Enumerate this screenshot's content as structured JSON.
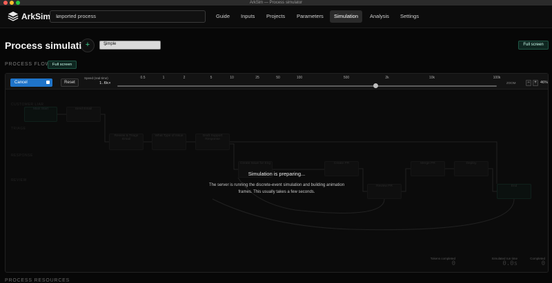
{
  "window": {
    "title": "ArkSim — Process simulator"
  },
  "app": {
    "brand": "ArkSim",
    "process_select": "Imported process",
    "nav": [
      "Guide",
      "Inputs",
      "Projects",
      "Parameters",
      "Simulation",
      "Analysis",
      "Settings"
    ],
    "active_nav": "Simulation"
  },
  "page": {
    "title": "Process simulation",
    "add_label": "+",
    "sim_mode": "Simple",
    "full_screen": "Full screen"
  },
  "section": {
    "label": "PROCESS FLOW",
    "full_screen": "Full screen"
  },
  "toolbar": {
    "cancel": "Cancel",
    "reset": "Reset",
    "speed_label": "Speed (real-time)",
    "speed_value": "1.6k×",
    "speed_ticks": [
      "0.5",
      "1",
      "2",
      "5",
      "10",
      "25",
      "50",
      "100",
      "500",
      "2k",
      "10k",
      "100k"
    ],
    "speed_position": 0.68,
    "zoom_label": "ZOOM",
    "zoom_minus": "−",
    "zoom_plus": "+",
    "zoom_value": "46%"
  },
  "diagram": {
    "lanes": [
      "CUSTOMER LIAR",
      "TRIAGE",
      "RESPONSE",
      "REVIEW"
    ],
    "nodes": [
      "Main Start",
      "Send Email",
      "Review & Triage Email",
      "What Type of Issue",
      "Draft Support Response",
      "Create Issue for Eng",
      "Create PR",
      "Review PR",
      "Merge PR",
      "Deploy",
      "End"
    ]
  },
  "overlay": {
    "title": "Simulation is preparing...",
    "message": "The server is running the discrete-event simulation and building animation frames. This usually takes a few seconds."
  },
  "stats": [
    {
      "label": "Tokens completed",
      "value": "0"
    },
    {
      "label": "Simulated run time",
      "value": "0.0s"
    },
    {
      "label": "Completed",
      "value": "0"
    }
  ],
  "bottom_section": "PROCESS RESOURCES",
  "colors": {
    "accent": "#1f74c9",
    "success": "#3fd08f",
    "background": "#070707"
  }
}
